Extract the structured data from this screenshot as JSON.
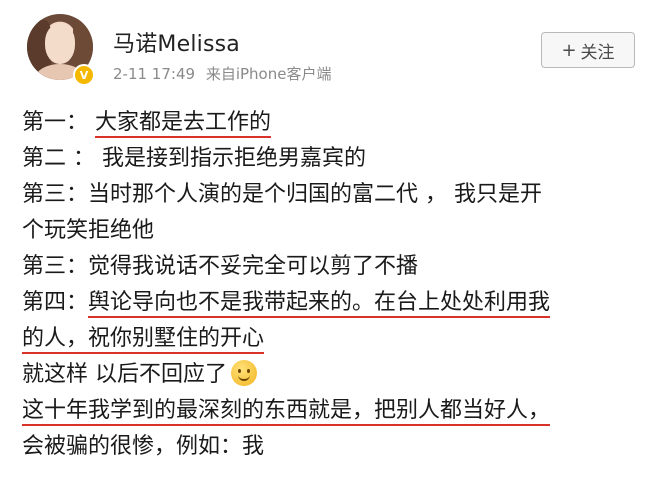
{
  "post": {
    "author": "马诺Melissa",
    "time": "2-11 17:49",
    "source": "来自iPhone客户端",
    "follow_label": "关注",
    "follow_plus": "+",
    "verified_icon": "V"
  },
  "lines": [
    {
      "pre": "第一： ",
      "ul": "大家都是去工作的",
      "post": ""
    },
    {
      "pre": "第二 ： 我是接到指示拒绝男嘉宾的",
      "ul": "",
      "post": ""
    },
    {
      "pre": "第三：当时那个人演的是个归国的富二代 ， 我只是开",
      "ul": "",
      "post": ""
    },
    {
      "pre": "个玩笑拒绝他",
      "ul": "",
      "post": ""
    },
    {
      "pre": "第三：觉得我说话不妥完全可以剪了不播",
      "ul": "",
      "post": ""
    },
    {
      "pre": "第四：",
      "ul": "舆论导向也不是我带起来的。在台上处处利用我",
      "post": ""
    },
    {
      "pre": "",
      "ul": "的人，祝你别墅住的开心",
      "post": ""
    },
    {
      "pre": "就这样 以后不回应了",
      "ul": "",
      "post": ""
    },
    {
      "pre": "",
      "ul": "这十年我学到的最深刻的东西就是，把别人都当好人，",
      "post": ""
    },
    {
      "pre": "会被骗的很惨，例如：我",
      "ul": "",
      "post": ""
    }
  ],
  "emoji": "smiley-icon",
  "colors": {
    "underline": "#d8322a",
    "meta": "#8a8a8a",
    "badge": "#f5b800"
  }
}
